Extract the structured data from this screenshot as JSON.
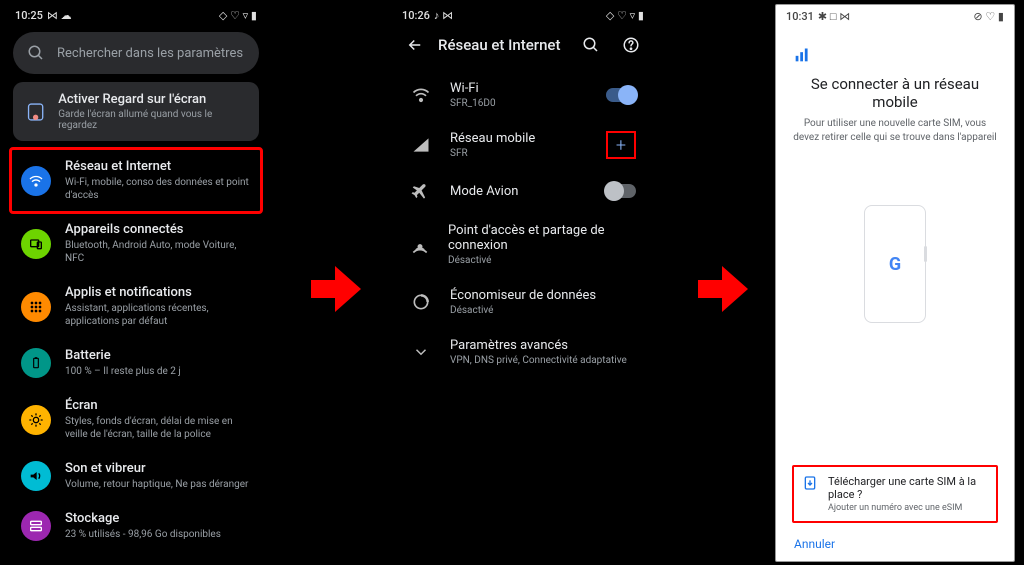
{
  "screen1": {
    "status": {
      "time": "10:25",
      "icons_left": "⋈ ☁",
      "icons_right": "◇ ♡ ▿ ▮"
    },
    "search_placeholder": "Rechercher dans les paramètres",
    "banner": {
      "title": "Activer Regard sur l'écran",
      "sub": "Garde l'écran allumé quand vous le regardez"
    },
    "items": [
      {
        "title": "Réseau et Internet",
        "sub": "Wi-Fi, mobile, conso des données et point d'accès",
        "color": "#1a73e8"
      },
      {
        "title": "Appareils connectés",
        "sub": "Bluetooth, Android Auto, mode Voiture, NFC",
        "color": "#6dd400"
      },
      {
        "title": "Applis et notifications",
        "sub": "Assistant, applications récentes, applications par défaut",
        "color": "#ff8a00"
      },
      {
        "title": "Batterie",
        "sub": "100 % – Il reste plus de 2 j",
        "color": "#009688"
      },
      {
        "title": "Écran",
        "sub": "Styles, fonds d'écran, délai de mise en veille de l'écran, taille de la police",
        "color": "#ffb300"
      },
      {
        "title": "Son et vibreur",
        "sub": "Volume, retour haptique, Ne pas déranger",
        "color": "#00bcd4"
      },
      {
        "title": "Stockage",
        "sub": "23 % utilisés - 98,96 Go disponibles",
        "color": "#9c27b0"
      }
    ]
  },
  "screen2": {
    "status": {
      "time": "10:26",
      "icons_left": "♪ ⋈",
      "icons_right": "◇ ♡ ▿ ▮"
    },
    "title": "Réseau et Internet",
    "items": [
      {
        "title": "Wi-Fi",
        "sub": "SFR_16D0",
        "trail": "switch_on"
      },
      {
        "title": "Réseau mobile",
        "sub": "SFR",
        "trail": "plus_hl"
      },
      {
        "title": "Mode Avion",
        "sub": "",
        "trail": "switch_off"
      },
      {
        "title": "Point d'accès et partage de connexion",
        "sub": "Désactivé",
        "trail": ""
      },
      {
        "title": "Économiseur de données",
        "sub": "Désactivé",
        "trail": ""
      },
      {
        "title": "Paramètres avancés",
        "sub": "VPN, DNS privé, Connectivité adaptative",
        "trail": ""
      }
    ]
  },
  "screen3": {
    "status": {
      "time": "10:31",
      "icons_left": "✱ □ ⋈",
      "icons_right": "⊘ ♡ ▮"
    },
    "heading": "Se connecter à un réseau mobile",
    "sub": "Pour utiliser une nouvelle carte SIM, vous devez retirer celle qui se trouve dans l'appareil",
    "esim_title": "Télécharger une carte SIM à la place ?",
    "esim_sub": "Ajouter un numéro avec une eSIM",
    "cancel": "Annuler"
  }
}
